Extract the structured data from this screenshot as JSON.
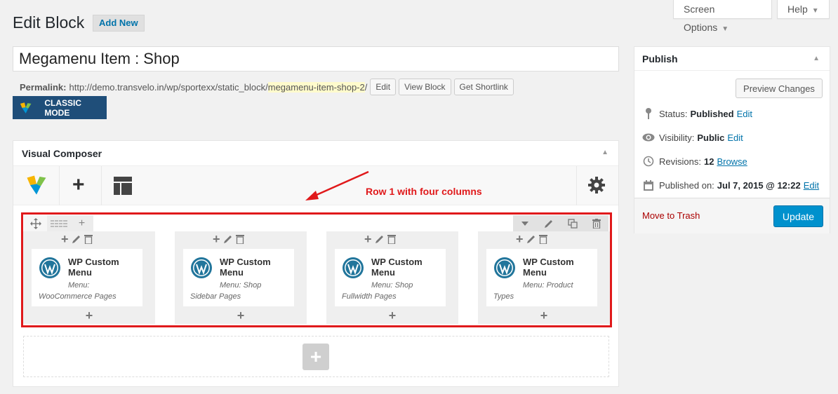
{
  "header": {
    "title": "Edit Block",
    "add_new": "Add New",
    "screen_options": "Screen Options",
    "help": "Help"
  },
  "post": {
    "title_value": "Megamenu Item : Shop",
    "permalink_label": "Permalink:",
    "permalink_base": "http://demo.transvelo.in/wp/sportexx/static_block/",
    "permalink_slug": "megamenu-item-shop-2",
    "permalink_trailing": "/",
    "edit_btn": "Edit",
    "view_btn": "View Block",
    "shortlink_btn": "Get Shortlink",
    "classic_mode": "CLASSIC MODE"
  },
  "vc": {
    "panel_title": "Visual Composer",
    "annotation": "Row 1 with four columns",
    "columns": [
      {
        "title": "WP Custom Menu",
        "menu": "Menu: WooCommerce Pages"
      },
      {
        "title": "WP Custom Menu",
        "menu": "Menu: Shop Sidebar Pages"
      },
      {
        "title": "WP Custom Menu",
        "menu": "Menu: Shop Fullwidth Pages"
      },
      {
        "title": "WP Custom Menu",
        "menu": "Menu: Product Types"
      }
    ],
    "add_element": "+"
  },
  "publish": {
    "title": "Publish",
    "preview": "Preview Changes",
    "status_label": "Status:",
    "status_value": "Published",
    "visibility_label": "Visibility:",
    "visibility_value": "Public",
    "revisions_label": "Revisions:",
    "revisions_value": "12",
    "browse": "Browse",
    "published_label": "Published on:",
    "published_value": "Jul 7, 2015 @ 12:22",
    "edit": "Edit",
    "trash": "Move to Trash",
    "update": "Update"
  },
  "colors": {
    "accent": "#0073aa",
    "update_button": "#0091cd",
    "annotation_red": "#e0191b",
    "classic_mode_bg": "#1f4e79"
  }
}
